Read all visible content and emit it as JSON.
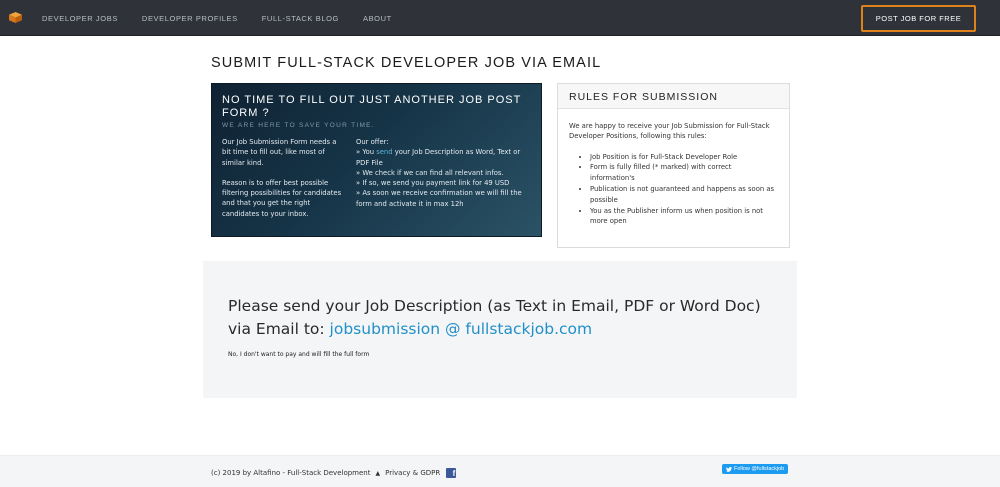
{
  "nav": {
    "items": [
      {
        "label": "DEVELOPER JOBS"
      },
      {
        "label": "DEVELOPER PROFILES"
      },
      {
        "label": "FULL-STACK BLOG"
      },
      {
        "label": "ABOUT"
      }
    ],
    "post_button": "POST JOB FOR FREE",
    "logo_icon": "cube-logo-icon",
    "accent_color": "#e0821a"
  },
  "page": {
    "title": "SUBMIT FULL-STACK DEVELOPER JOB VIA EMAIL"
  },
  "promo": {
    "title": "NO TIME TO FILL OUT JUST ANOTHER JOB POST FORM ?",
    "subtitle": "WE ARE HERE TO SAVE YOUR TIME.",
    "left_p1": "Our Job Submission Form needs a bit time to fill out, like most of similar kind.",
    "left_p2": "Reason is to offer best possible filtering possibilities for candidates and that you get the right candidates to your inbox.",
    "offer_heading": "Our offer:",
    "offer_1_pre": "» You ",
    "offer_1_link": "send",
    "offer_1_post": " your Job Description as Word, Text or PDF File",
    "offer_2": "» We check if we can find all relevant infos.",
    "offer_3": "» If so, we send you payment link for 49 USD",
    "offer_4": "» As soon we receive confirmation we will fill the form and activate it in max 12h"
  },
  "rules": {
    "heading": "RULES FOR SUBMISSION",
    "intro": "We are happy to receive your Job Submission for Full-Stack Developer Positions, following this rules:",
    "items": [
      "Job Position is for Full-Stack Developer Role",
      "Form is fully filled (* marked) with correct information's",
      "Publication is not guaranteed and happens as soon as possible",
      "You as the Publisher inform us when position is not more open"
    ]
  },
  "email": {
    "line1": "Please send your Job Description (as Text in Email, PDF or Word Doc)",
    "line2_prefix": "via Email to: ",
    "address": "jobsubmission @ fullstackjob.com",
    "skip_text": "No, I don't want to pay and will fill the full form",
    "link_color": "#2290c8"
  },
  "footer": {
    "copyright": "(c) 2019 by Altafino - Full-Stack Development",
    "privacy": "Privacy & GDPR",
    "facebook_icon": "facebook-icon",
    "twitter_label": "Follow @fullstackjob",
    "twitter_icon": "twitter-bird-icon"
  }
}
